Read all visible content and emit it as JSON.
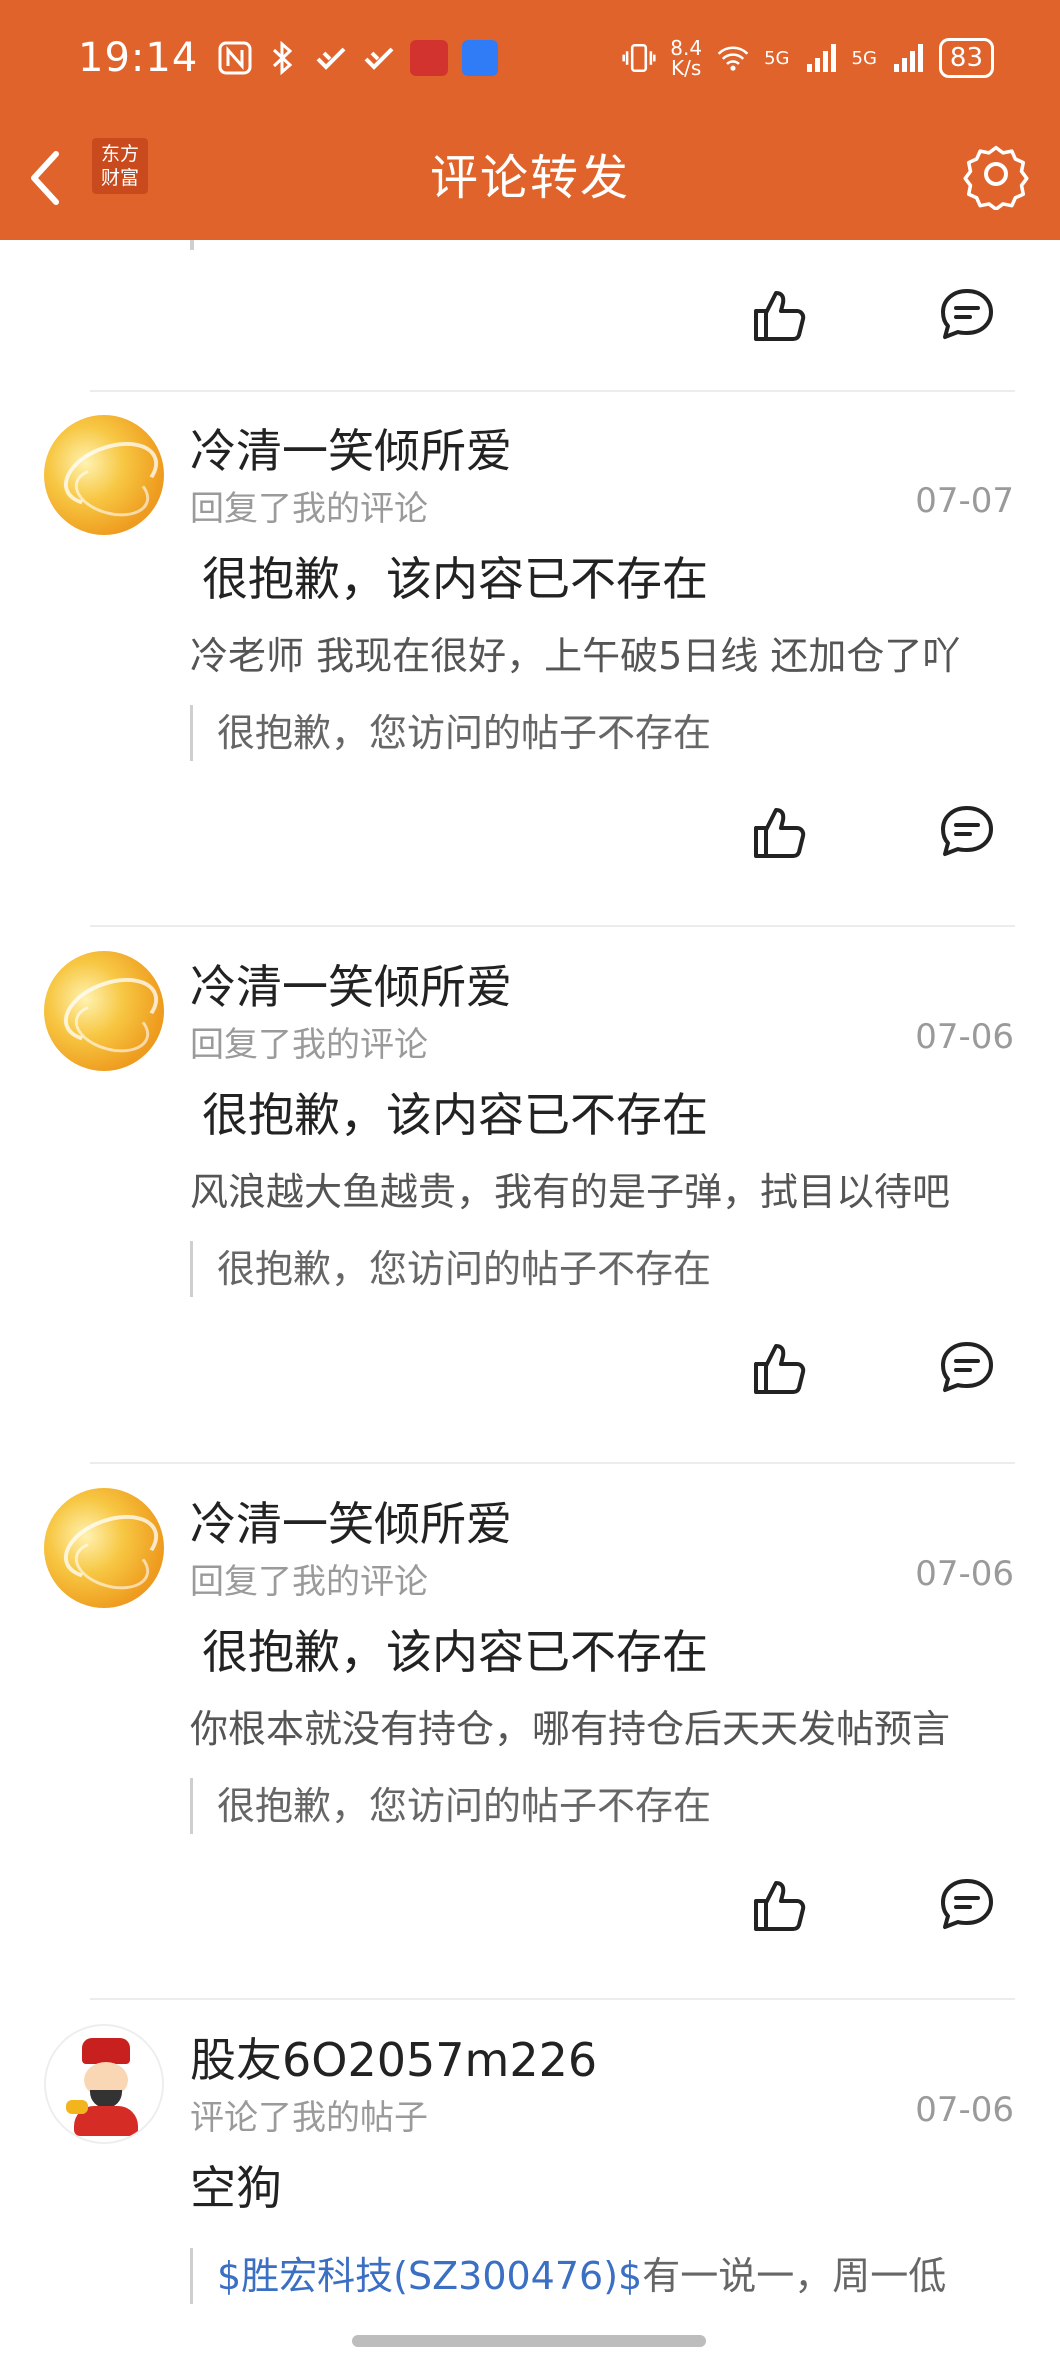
{
  "status_bar": {
    "time": "19:14",
    "net_speed_top": "8.4",
    "net_speed_unit": "K/s",
    "signal1": "5G",
    "signal2": "5G",
    "battery": "83"
  },
  "header": {
    "title": "评论转发",
    "logo_line1": "东方",
    "logo_line2": "财富",
    "accent_color": "#e0632b"
  },
  "items": [
    {
      "username": "冷清一笑倾所爱",
      "action": "回复了我的评论",
      "date": "07-07",
      "title": "很抱歉，该内容已不存在",
      "text": "冷老师 我现在很好，上午破5日线 还加仓了吖",
      "quote": "很抱歉，您访问的帖子不存在"
    },
    {
      "username": "冷清一笑倾所爱",
      "action": "回复了我的评论",
      "date": "07-06",
      "title": "很抱歉，该内容已不存在",
      "text": "风浪越大鱼越贵，我有的是子弹，拭目以待吧",
      "quote": "很抱歉，您访问的帖子不存在"
    },
    {
      "username": "冷清一笑倾所爱",
      "action": "回复了我的评论",
      "date": "07-06",
      "title": "很抱歉，该内容已不存在",
      "text": "你根本就没有持仓，哪有持仓后天天发帖预言",
      "quote": "很抱歉，您访问的帖子不存在"
    },
    {
      "username": "股友6O2057m226",
      "action": "评论了我的帖子",
      "date": "07-06",
      "title": "空狗",
      "quote_link": "$胜宏科技(SZ300476)$",
      "quote_rest": "有一说一，周一低"
    }
  ]
}
